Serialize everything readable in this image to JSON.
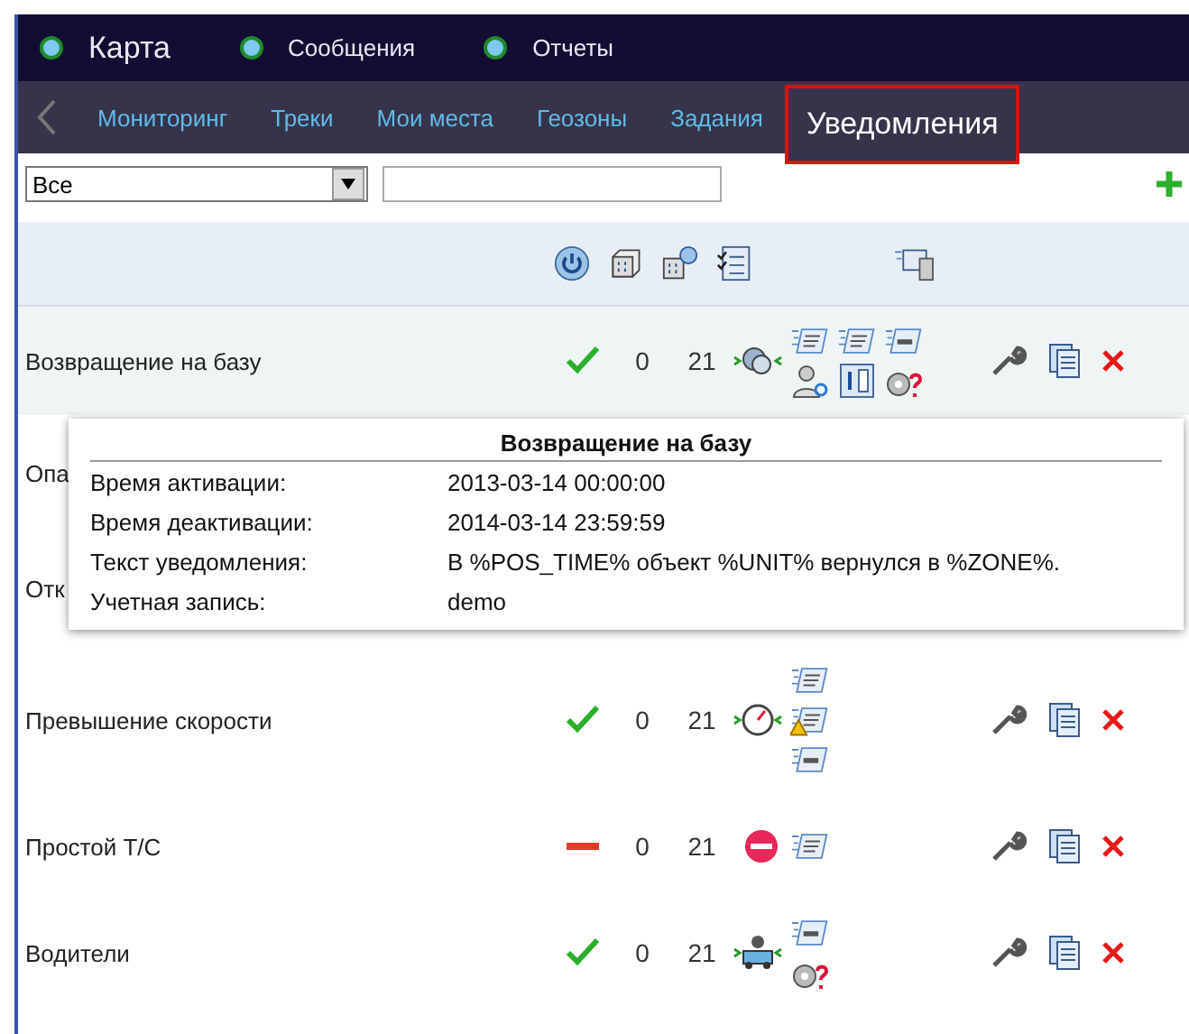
{
  "top_menu": [
    {
      "label": "Карта",
      "large": true
    },
    {
      "label": "Сообщения",
      "large": false
    },
    {
      "label": "Отчеты",
      "large": false
    }
  ],
  "nav_tabs": [
    {
      "label": "Мониторинг",
      "selected": false
    },
    {
      "label": "Треки",
      "selected": false
    },
    {
      "label": "Мои места",
      "selected": false
    },
    {
      "label": "Геозоны",
      "selected": false
    },
    {
      "label": "Задания",
      "selected": false
    },
    {
      "label": "Уведомления",
      "selected": true
    }
  ],
  "filter": {
    "select_value": "Все"
  },
  "header_icons": [
    {
      "kind": "power"
    },
    {
      "kind": "units"
    },
    {
      "kind": "unit-groups"
    },
    {
      "kind": "checklist"
    },
    {
      "kind": "gap"
    },
    {
      "kind": "sms-device"
    }
  ],
  "rows": [
    {
      "name": "Возвращение на базу",
      "kind": "zone",
      "active": true,
      "count_1": "0",
      "count_2": "21",
      "hovered": true,
      "notify": [
        [
          {
            "kind": "note"
          },
          {
            "kind": "list"
          },
          {
            "kind": "note-bar"
          }
        ],
        [
          {
            "kind": "user"
          },
          {
            "kind": "counter"
          },
          {
            "kind": "unknown"
          }
        ]
      ]
    },
    {
      "name": "Опа",
      "kind": "covered",
      "hovered": false
    },
    {
      "name": "Отк",
      "kind": "covered",
      "hovered": false
    },
    {
      "name": "Превышение скорости",
      "kind": "speed",
      "active": true,
      "count_1": "0",
      "count_2": "21",
      "hovered": false,
      "notify": [
        [
          {
            "kind": "note"
          }
        ],
        [
          {
            "kind": "warning-note"
          }
        ],
        [
          {
            "kind": "note-bar"
          }
        ]
      ]
    },
    {
      "name": "Простой Т/С",
      "kind": "stop",
      "active": false,
      "count_1": "0",
      "count_2": "21",
      "hovered": false,
      "notify": [
        [
          {
            "kind": "note"
          }
        ]
      ]
    },
    {
      "name": "Водители",
      "kind": "driver",
      "active": true,
      "count_1": "0",
      "count_2": "21",
      "hovered": false,
      "notify": [
        [
          {
            "kind": "note-bar"
          }
        ],
        [
          {
            "kind": "unknown"
          }
        ]
      ]
    }
  ],
  "tooltip": {
    "title": "Возвращение на базу",
    "fields": [
      {
        "label": "Время активации:",
        "value": "2013-03-14 00:00:00"
      },
      {
        "label": "Время деактивации:",
        "value": "2014-03-14 23:59:59"
      },
      {
        "label": "Текст уведомления:",
        "value": "В %POS_TIME% объект %UNIT% вернулся в %ZONE%."
      },
      {
        "label": "Учетная запись:",
        "value": "demo"
      }
    ]
  }
}
